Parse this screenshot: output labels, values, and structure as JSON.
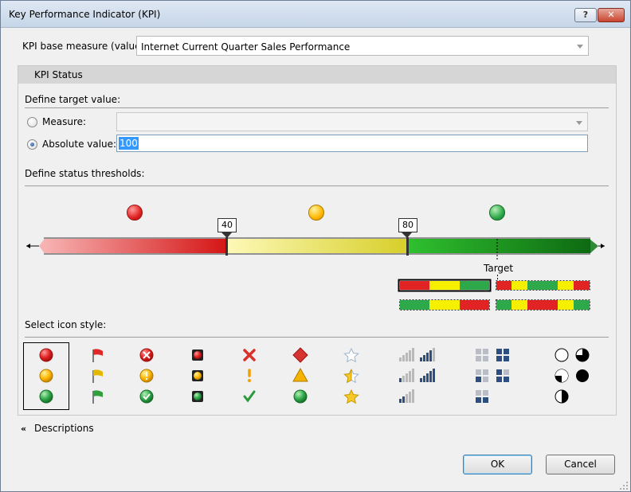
{
  "window": {
    "title": "Key Performance Indicator (KPI)",
    "help_label": "?",
    "close_label": "✕"
  },
  "base_measure": {
    "label": "KPI base measure (value):",
    "value": "Internet Current Quarter Sales Performance"
  },
  "kpi_status": {
    "header": "KPI Status",
    "target_section": "Define target value:",
    "measure_label": "Measure:",
    "measure_value": "",
    "absolute_label": "Absolute value:",
    "absolute_value": "100",
    "selected_option": "absolute",
    "thresholds_section": "Define status thresholds:",
    "threshold_low": "40",
    "threshold_high": "80",
    "target_label": "Target",
    "icon_style_section": "Select icon style:"
  },
  "colors": {
    "red": "#e23030",
    "yellow": "#f4c400",
    "green": "#25a23a",
    "accent": "#3399ff"
  },
  "icon_styles": [
    [
      "red-circle-icon",
      "yellow-circle-icon",
      "green-circle-icon"
    ],
    [
      "red-flag-icon",
      "yellow-flag-icon",
      "green-flag-icon"
    ],
    [
      "error-x-circle-icon",
      "warning-exclamation-circle-icon",
      "ok-check-circle-icon"
    ],
    [
      "red-traffic-light-icon",
      "yellow-traffic-light-icon",
      "green-traffic-light-icon"
    ],
    [
      "red-x-icon",
      "yellow-exclamation-icon",
      "green-check-icon"
    ],
    [
      "red-diamond-icon",
      "yellow-triangle-icon",
      "green-circle-icon"
    ],
    [
      "empty-star-icon",
      "half-star-icon",
      "full-star-icon"
    ],
    [
      "signal-bars-icon",
      "signal-bars-icon",
      "signal-bars-icon"
    ],
    [
      "quad-squares-icon",
      "quad-squares-icon",
      "quad-squares-icon"
    ],
    [
      "pie-quarter-icon",
      "pie-three-quarter-icon",
      "pie-half-icon"
    ]
  ],
  "descriptions_label": "Descriptions",
  "buttons": {
    "ok": "OK",
    "cancel": "Cancel"
  }
}
